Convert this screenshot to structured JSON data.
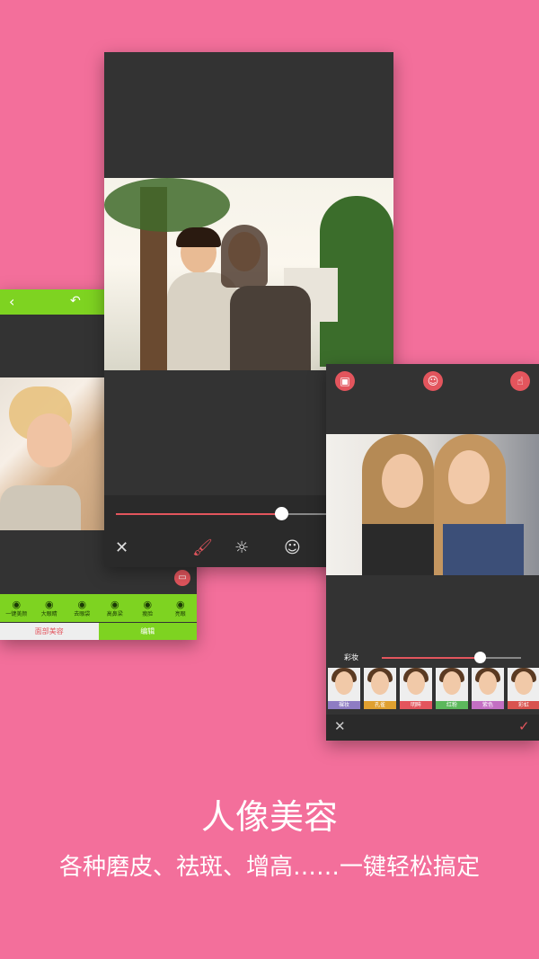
{
  "colors": {
    "background": "#f36f9b",
    "accent_green": "#7ed321",
    "accent_red": "#e3555d",
    "panel_dark": "#333333"
  },
  "left_phone": {
    "back_icon": "chevron-left-icon",
    "undo_icon": "undo-icon",
    "tools": [
      {
        "label": "一键美颜",
        "icon": "face-icon"
      },
      {
        "label": "大眼睛",
        "icon": "eye-icon"
      },
      {
        "label": "去眼袋",
        "icon": "eye-icon"
      },
      {
        "label": "高鼻梁",
        "icon": "nose-icon"
      },
      {
        "label": "瘦脸",
        "icon": "face-slim-icon"
      },
      {
        "label": "亮眼",
        "icon": "eye-bright-icon"
      }
    ],
    "tabs": [
      {
        "label": "面部美容",
        "active": true
      },
      {
        "label": "编辑",
        "active": false
      }
    ]
  },
  "center_phone": {
    "slider_level": 0.62,
    "tools": [
      {
        "name": "close",
        "glyph": "✕"
      },
      {
        "name": "brush",
        "glyph": "🖌"
      },
      {
        "name": "brightness",
        "glyph": "☼"
      },
      {
        "name": "face-mask",
        "glyph": "☺"
      }
    ]
  },
  "right_phone": {
    "slider_label": "彩妆",
    "slider_level": 0.7,
    "thumbnails": [
      {
        "label": "裸妆",
        "color": "#8e7cc3"
      },
      {
        "label": "孔雀",
        "color": "#e0a030"
      },
      {
        "label": "明眸",
        "color": "#e3555d"
      },
      {
        "label": "红粉",
        "color": "#5cb85c"
      },
      {
        "label": "紫色",
        "color": "#c36fc3"
      },
      {
        "label": "彩虹",
        "color": "#d9534f"
      }
    ],
    "cancel_glyph": "✕",
    "confirm_glyph": "✓"
  },
  "headline": "人像美容",
  "subline": "各种磨皮、祛斑、增高……一键轻松搞定"
}
